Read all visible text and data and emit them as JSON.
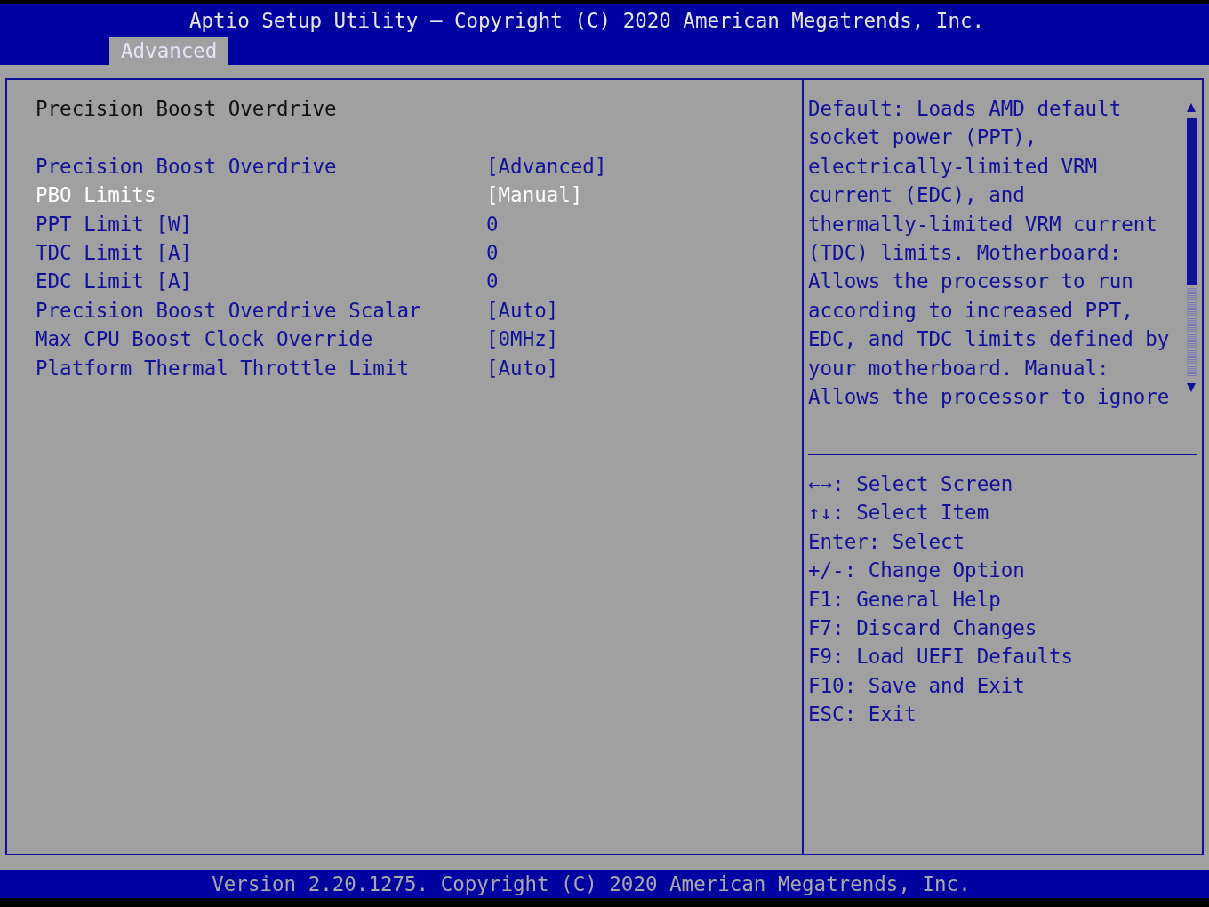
{
  "header": {
    "title": "Aptio Setup Utility – Copyright (C) 2020 American Megatrends, Inc."
  },
  "tabs": [
    {
      "label": "Advanced",
      "selected": true
    }
  ],
  "page_title": "Precision Boost Overdrive",
  "settings": [
    {
      "label": "Precision Boost Overdrive",
      "value": "[Advanced]",
      "selected": false
    },
    {
      "label": "PBO Limits",
      "value": "[Manual]",
      "selected": true
    },
    {
      "label": "PPT Limit [W]",
      "value": "0",
      "selected": false
    },
    {
      "label": "TDC Limit [A]",
      "value": "0",
      "selected": false
    },
    {
      "label": "EDC Limit [A]",
      "value": "0",
      "selected": false
    },
    {
      "label": "Precision Boost Overdrive Scalar",
      "value": "[Auto]",
      "selected": false
    },
    {
      "label": "Max CPU Boost Clock Override",
      "value": "[0MHz]",
      "selected": false
    },
    {
      "label": "Platform Thermal Throttle Limit",
      "value": "[Auto]",
      "selected": false
    }
  ],
  "help_text": [
    "Default: Loads AMD default",
    "socket power (PPT),",
    "electrically-limited VRM",
    "current (EDC), and",
    "thermally-limited VRM current",
    "(TDC) limits. Motherboard:",
    "Allows the processor to run",
    "according to increased PPT,",
    "EDC, and TDC limits defined by",
    "your motherboard. Manual:",
    "Allows the processor to ignore"
  ],
  "key_help": [
    "←→: Select Screen",
    "↑↓: Select Item",
    "Enter: Select",
    "+/-: Change Option",
    "F1: General Help",
    "F7: Discard Changes",
    "F9: Load UEFI Defaults",
    "F10: Save and Exit",
    "ESC: Exit"
  ],
  "footer": "Version 2.20.1275. Copyright (C) 2020 American Megatrends, Inc."
}
